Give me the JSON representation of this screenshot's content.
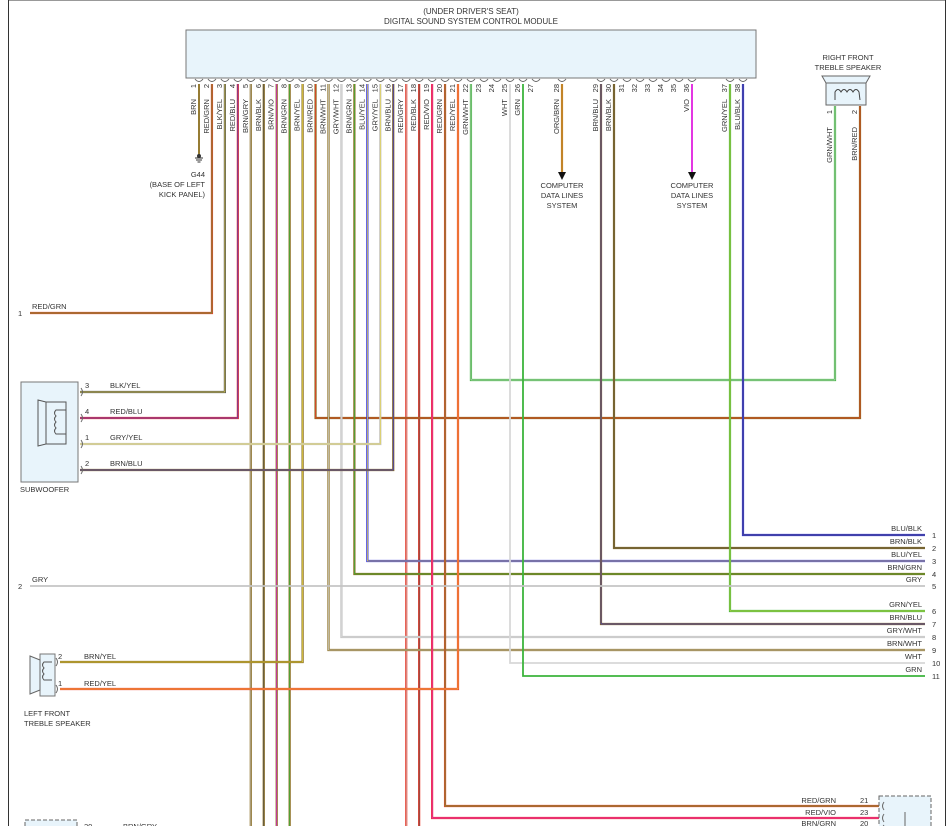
{
  "module": {
    "location": "(UNDER DRIVER'S SEAT)",
    "title": "DIGITAL SOUND SYSTEM CONTROL MODULE",
    "pins": [
      {
        "num": "1",
        "color": "BRN"
      },
      {
        "num": "2",
        "color": "RED/GRN"
      },
      {
        "num": "3",
        "color": "BLK/YEL"
      },
      {
        "num": "4",
        "color": "RED/BLU"
      },
      {
        "num": "5",
        "color": "BRN/GRY"
      },
      {
        "num": "6",
        "color": "BRN/BLK"
      },
      {
        "num": "7",
        "color": "BRN/VIO"
      },
      {
        "num": "8",
        "color": "BRN/GRN"
      },
      {
        "num": "9",
        "color": "BRN/YEL"
      },
      {
        "num": "10",
        "color": "BRN/RED"
      },
      {
        "num": "11",
        "color": "BRN/WHT"
      },
      {
        "num": "12",
        "color": "GRY/WHT"
      },
      {
        "num": "13",
        "color": "BRN/GRN"
      },
      {
        "num": "14",
        "color": "BLU/YEL"
      },
      {
        "num": "15",
        "color": "GRY/YEL"
      },
      {
        "num": "16",
        "color": "BRN/BLU"
      },
      {
        "num": "17",
        "color": "RED/GRY"
      },
      {
        "num": "18",
        "color": "RED/BLK"
      },
      {
        "num": "19",
        "color": "RED/VIO"
      },
      {
        "num": "20",
        "color": "RED/GRN"
      },
      {
        "num": "21",
        "color": "RED/YEL"
      },
      {
        "num": "22",
        "color": "GRN/WHT"
      },
      {
        "num": "23",
        "color": ""
      },
      {
        "num": "24",
        "color": ""
      },
      {
        "num": "25",
        "color": "WHT"
      },
      {
        "num": "26",
        "color": "GRN"
      },
      {
        "num": "27",
        "color": ""
      },
      {
        "num": "28",
        "color": "ORG/BRN"
      },
      {
        "num": "29",
        "color": "BRN/BLU"
      },
      {
        "num": "30",
        "color": "BRN/BLK"
      },
      {
        "num": "31",
        "color": ""
      },
      {
        "num": "32",
        "color": ""
      },
      {
        "num": "33",
        "color": ""
      },
      {
        "num": "34",
        "color": ""
      },
      {
        "num": "35",
        "color": ""
      },
      {
        "num": "36",
        "color": "VIO"
      },
      {
        "num": "37",
        "color": "GRN/YEL"
      },
      {
        "num": "38",
        "color": "BLU/BLK"
      }
    ]
  },
  "ground": {
    "id": "G44",
    "desc": [
      "(BASE OF LEFT",
      "KICK PANEL)"
    ]
  },
  "computer_data_lines": [
    "COMPUTER",
    "DATA LINES",
    "SYSTEM"
  ],
  "right_front_treble": {
    "title": [
      "RIGHT FRONT",
      "TREBLE SPEAKER"
    ],
    "pins": [
      {
        "num": "1",
        "color": "GRN/WHT"
      },
      {
        "num": "2",
        "color": "BRN/RED"
      }
    ]
  },
  "subwoofer": {
    "title": "SUBWOOFER",
    "pins": [
      {
        "num": "3",
        "color": "BLK/YEL"
      },
      {
        "num": "4",
        "color": "RED/BLU"
      },
      {
        "num": "1",
        "color": "GRY/YEL"
      },
      {
        "num": "2",
        "color": "BRN/BLU"
      }
    ]
  },
  "left_front_treble": {
    "title": [
      "LEFT FRONT",
      "TREBLE SPEAKER"
    ],
    "pins": [
      {
        "num": "2",
        "color": "BRN/YEL"
      },
      {
        "num": "1",
        "color": "RED/YEL"
      }
    ]
  },
  "left_offpage": [
    {
      "num": "1",
      "color": "RED/GRN"
    },
    {
      "num": "2",
      "color": "GRY"
    }
  ],
  "right_connector": [
    {
      "num": "1",
      "color": "BLU/BLK"
    },
    {
      "num": "2",
      "color": "BRN/BLK"
    },
    {
      "num": "3",
      "color": "BLU/YEL"
    },
    {
      "num": "4",
      "color": "BRN/GRN"
    },
    {
      "num": "5",
      "color": "GRY"
    },
    {
      "num": "6",
      "color": "GRN/YEL"
    },
    {
      "num": "7",
      "color": "BRN/BLU"
    },
    {
      "num": "8",
      "color": "GRY/WHT"
    },
    {
      "num": "9",
      "color": "BRN/WHT"
    },
    {
      "num": "10",
      "color": "WHT"
    },
    {
      "num": "11",
      "color": "GRN"
    }
  ],
  "bottom_right_connector": [
    {
      "num": "21",
      "color": "RED/GRN"
    },
    {
      "num": "23",
      "color": "RED/VIO"
    },
    {
      "num": "20",
      "color": "BRN/GRN"
    }
  ],
  "bottom_left_connector": [
    {
      "num": "20",
      "color": "BRN/GRY"
    }
  ],
  "wire_colors": {
    "BRN": "#8a6d1e",
    "RED": "#f03a2a",
    "GRN": "#3cb43c",
    "YEL": "#e8d84a",
    "BLU": "#3434e0",
    "GRY": "#c4c4c4",
    "WHT": "#d8d8d8",
    "VIO": "#e020e0",
    "ORG": "#e0902e",
    "BLK": "#555555"
  }
}
